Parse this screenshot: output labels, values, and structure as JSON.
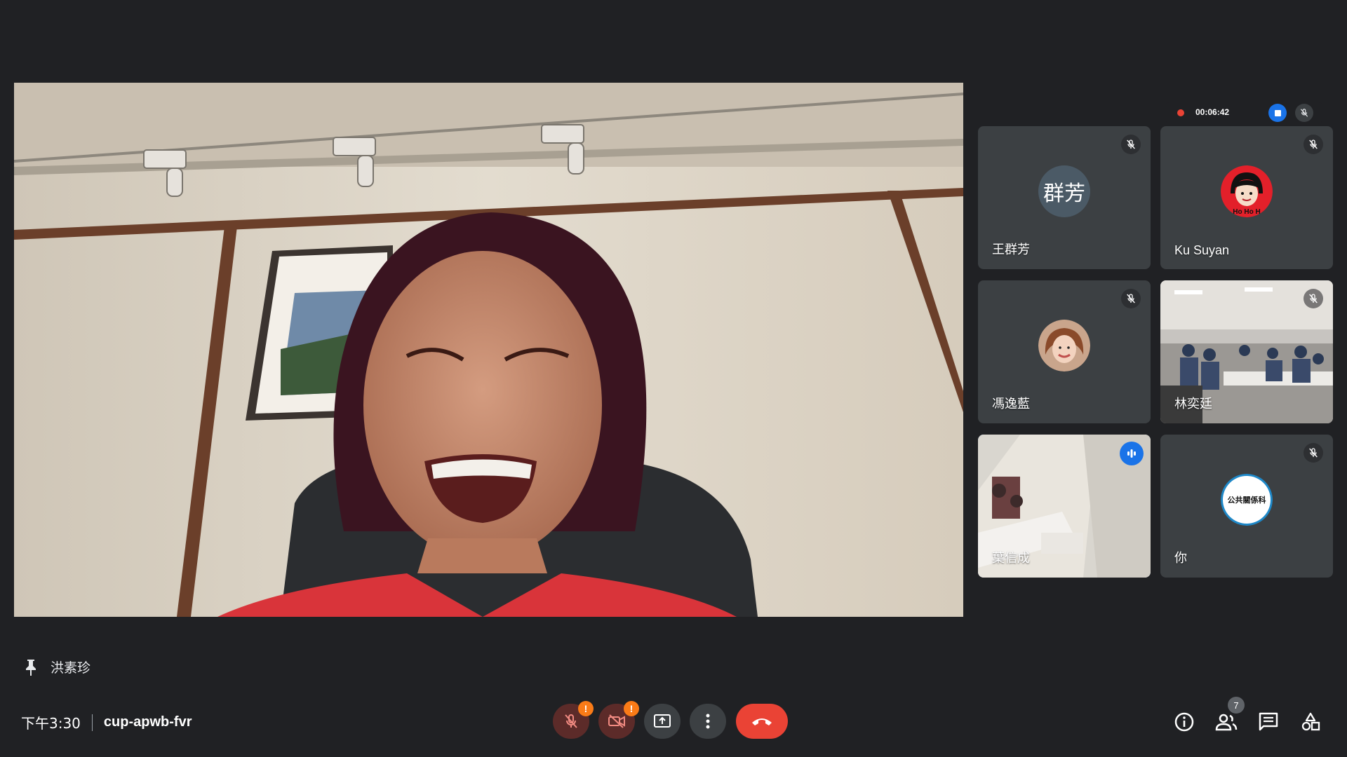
{
  "pinned": {
    "name": "洪素珍"
  },
  "recording": {
    "elapsed": "00:06:42"
  },
  "tiles": [
    {
      "name": "王群芳",
      "initials": "群芳",
      "muted": true
    },
    {
      "name": "Ku Suyan",
      "avatar_text": "Ho Ho H",
      "muted": true
    },
    {
      "name": "馮逸藍",
      "muted": true
    },
    {
      "name": "林奕廷",
      "muted": true
    },
    {
      "name": "葉信成",
      "speaking": true
    },
    {
      "name": "你",
      "avatar_text": "公共關係科",
      "muted": true
    }
  ],
  "meeting": {
    "time": "下午3:30",
    "code": "cup-apwb-fvr"
  },
  "controls": {
    "mic_warning": "!",
    "camera_warning": "!"
  },
  "people_count": "7",
  "colors": {
    "background": "#202124",
    "tile": "#3c4043",
    "end_call": "#ea4335",
    "active_speaker": "#8ab4f8",
    "record": "#ea4335",
    "warning": "#fa7b17"
  }
}
